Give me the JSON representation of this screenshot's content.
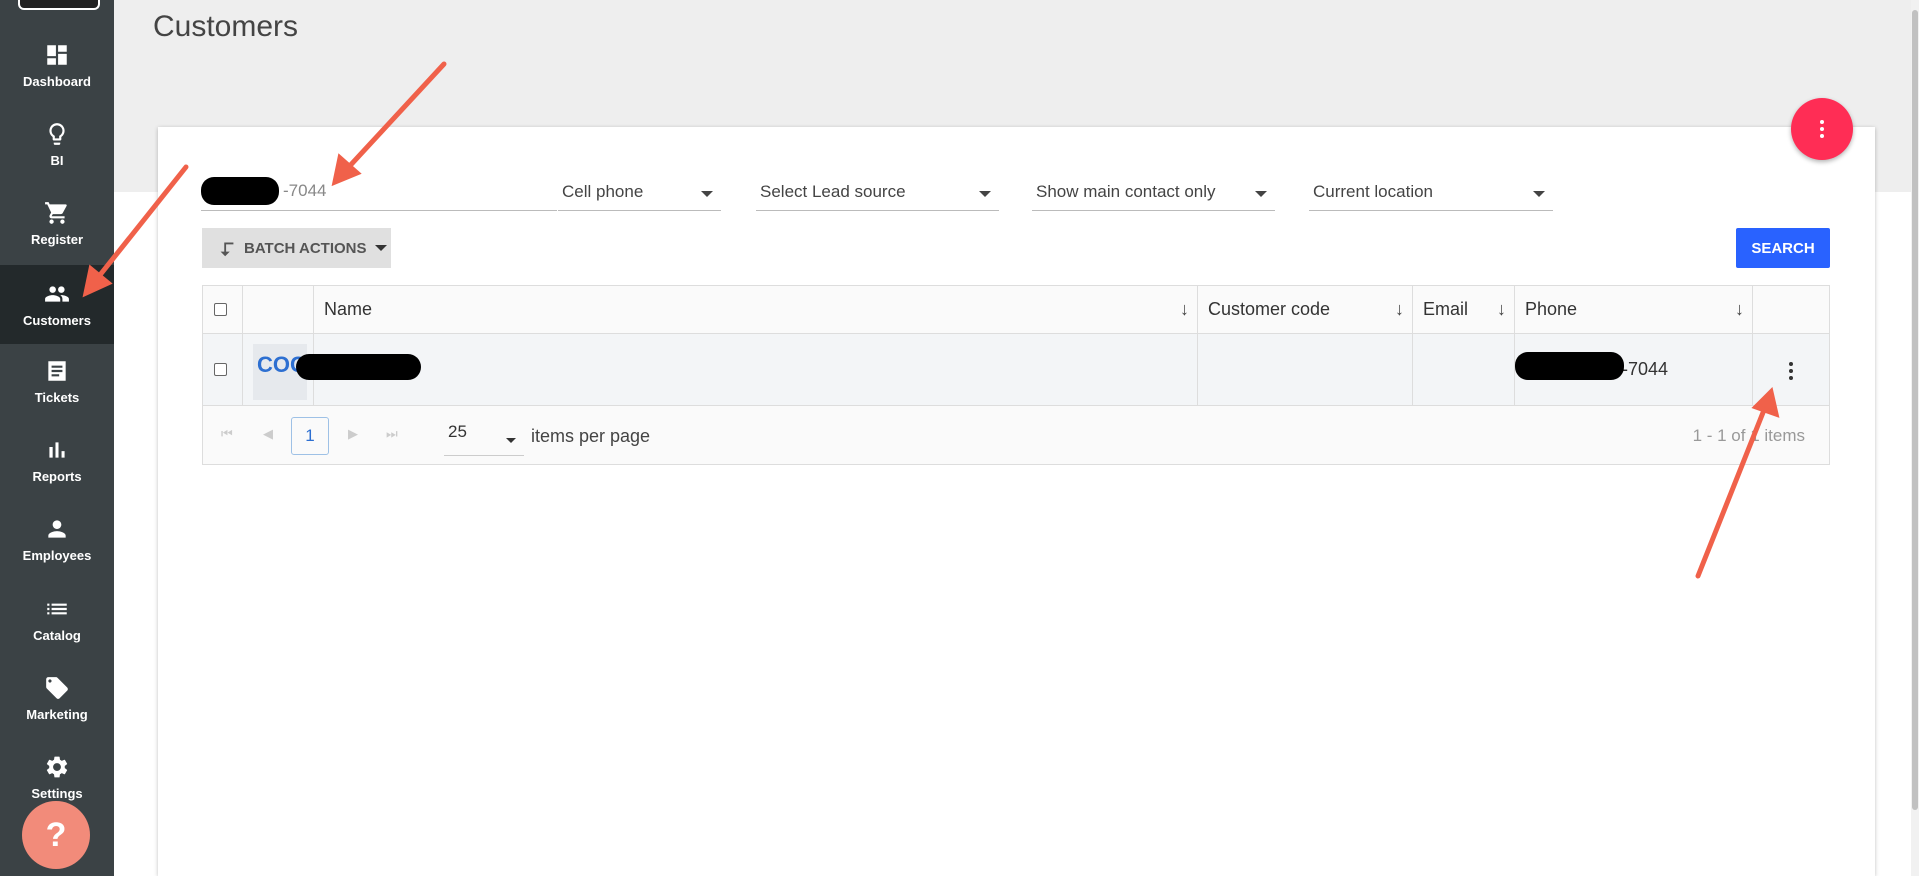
{
  "page": {
    "title": "Customers"
  },
  "sidebar": {
    "items": [
      {
        "label": "Dashboard",
        "icon": "dashboard-icon"
      },
      {
        "label": "BI",
        "icon": "lightbulb-icon"
      },
      {
        "label": "Register",
        "icon": "cart-icon"
      },
      {
        "label": "Customers",
        "icon": "people-icon",
        "active": true
      },
      {
        "label": "Tickets",
        "icon": "receipt-icon"
      },
      {
        "label": "Reports",
        "icon": "bar-chart-icon"
      },
      {
        "label": "Employees",
        "icon": "person-icon"
      },
      {
        "label": "Catalog",
        "icon": "list-icon"
      },
      {
        "label": "Marketing",
        "icon": "tag-icon"
      },
      {
        "label": "Settings",
        "icon": "gear-icon"
      }
    ],
    "help_label": "?"
  },
  "filters": {
    "search_value": "-7044",
    "phone_type": "Cell phone",
    "lead_source": "Select Lead source",
    "contact_filter": "Show main contact only",
    "location": "Current location"
  },
  "toolbar": {
    "batch_actions_label": "BATCH ACTIONS",
    "search_label": "SEARCH"
  },
  "table": {
    "columns": [
      "Name",
      "Customer code",
      "Email",
      "Phone"
    ],
    "sort_glyph": "↓",
    "rows": [
      {
        "avatar_text": "COC",
        "name": "",
        "customer_code": "",
        "email": "",
        "phone": "-7044"
      }
    ]
  },
  "pagination": {
    "current_page": "1",
    "page_size": "25",
    "page_size_label": "items per page",
    "info": "1 - 1 of 1 items"
  },
  "colors": {
    "sidebar": "#3b4245",
    "sidebar_active": "#23292b",
    "fab": "#ff2d55",
    "primary": "#2962ff",
    "link": "#2d6fd1",
    "annotation_arrow": "#f0614a"
  }
}
